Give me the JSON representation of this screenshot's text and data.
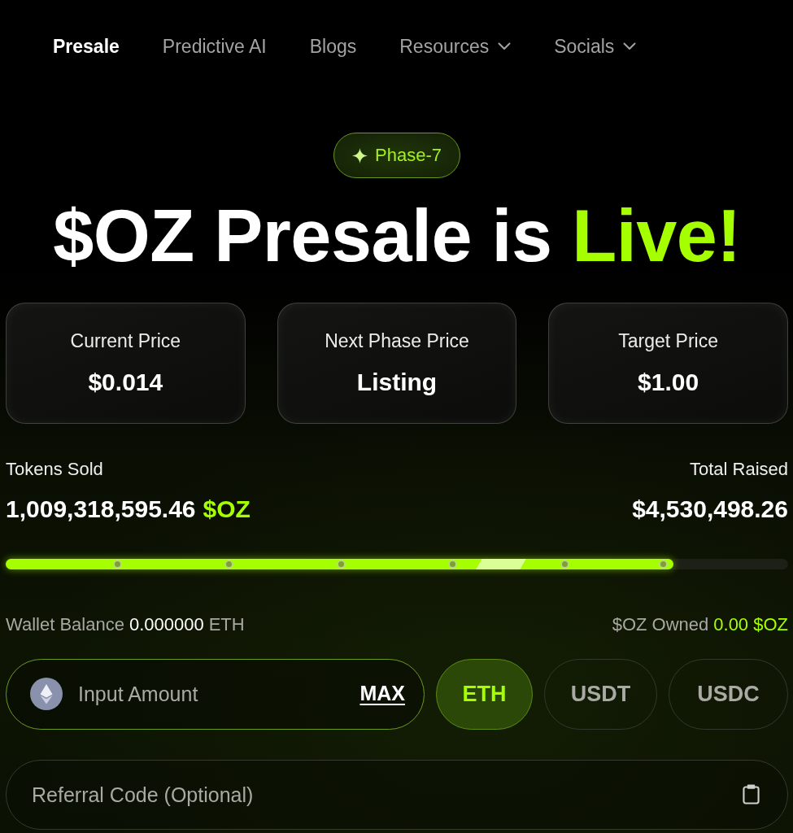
{
  "nav": [
    {
      "label": "Presale",
      "selected": true,
      "dropdown": false
    },
    {
      "label": "Predictive AI",
      "selected": false,
      "dropdown": false
    },
    {
      "label": "Blogs",
      "selected": false,
      "dropdown": false
    },
    {
      "label": "Resources",
      "selected": false,
      "dropdown": true
    },
    {
      "label": "Socials",
      "selected": false,
      "dropdown": true
    }
  ],
  "badge": {
    "label": "Phase-7"
  },
  "headline": {
    "text": "$OZ Presale is",
    "highlight": "Live!"
  },
  "price_cards": [
    {
      "label": "Current Price",
      "value": "$0.014"
    },
    {
      "label": "Next Phase Price",
      "value": "Listing"
    },
    {
      "label": "Target Price",
      "value": "$1.00"
    }
  ],
  "stats": {
    "tokens_sold": {
      "label": "Tokens Sold",
      "value": "1,009,318,595.46",
      "unit": "$OZ"
    },
    "total_raised": {
      "label": "Total Raised",
      "value": "$4,530,498.26"
    }
  },
  "progress": {
    "level": 0.853
  },
  "wallet": {
    "balance_label": "Wallet Balance",
    "balance_value": "0.000000",
    "balance_unit": "ETH",
    "owned_label": "$OZ Owned",
    "owned_value": "0.00 $OZ"
  },
  "amount_field": {
    "placeholder": "Input Amount",
    "max_label": "MAX"
  },
  "currencies": [
    {
      "label": "ETH",
      "selected": true
    },
    {
      "label": "USDT",
      "selected": false
    },
    {
      "label": "USDC",
      "selected": false
    }
  ],
  "referral_field": {
    "placeholder": "Referral Code (Optional)"
  }
}
